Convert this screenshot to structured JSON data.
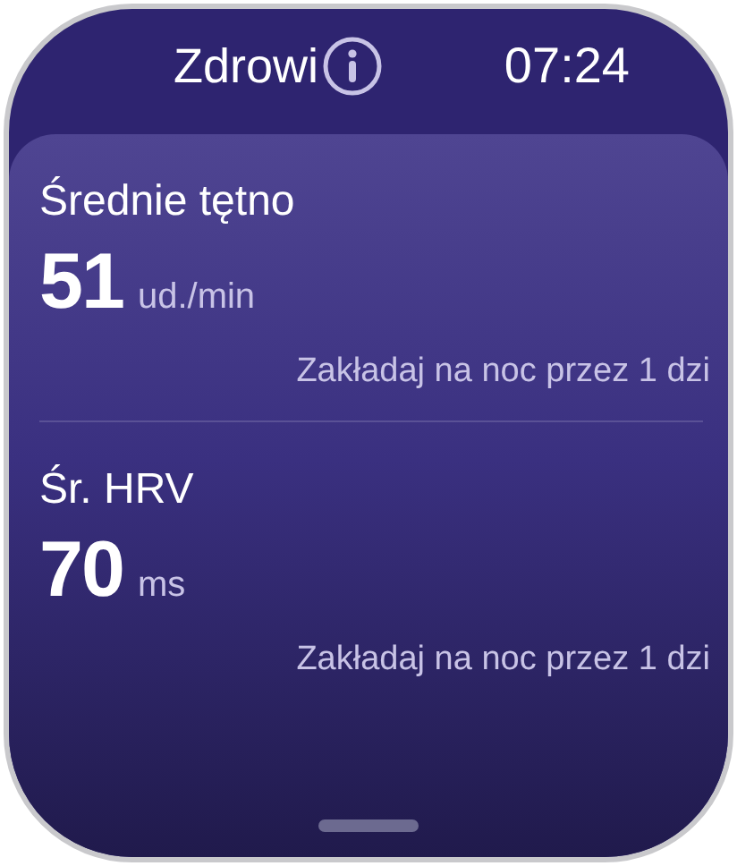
{
  "header": {
    "title": "Zdrowi",
    "time": "07:24"
  },
  "metrics": [
    {
      "label": "Średnie tętno",
      "value": "51",
      "unit": "ud./min",
      "hint": "Zakładaj na noc przez 1 dzi"
    },
    {
      "label": "Śr. HRV",
      "value": "70",
      "unit": "ms",
      "hint": "Zakładaj na noc przez 1 dzi"
    }
  ]
}
